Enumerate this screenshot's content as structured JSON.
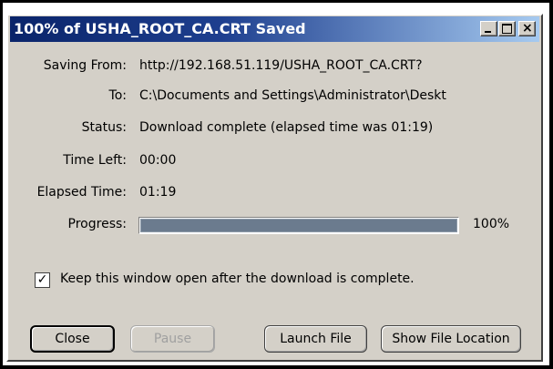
{
  "window": {
    "title": "100% of USHA_ROOT_CA.CRT Saved",
    "controls": {
      "minimize": "minimize-icon",
      "maximize": "maximize-icon",
      "close": "close-icon"
    }
  },
  "details": {
    "saving_from_label": "Saving From:",
    "saving_from_value": "http://192.168.51.119/USHA_ROOT_CA.CRT?",
    "to_label": "To:",
    "to_value": "C:\\Documents and Settings\\Administrator\\Deskt",
    "status_label": "Status:",
    "status_value": "Download complete (elapsed time was 01:19)",
    "time_left_label": "Time Left:",
    "time_left_value": "00:00",
    "elapsed_label": "Elapsed Time:",
    "elapsed_value": "01:19",
    "progress_label": "Progress:",
    "progress_text": "100%",
    "progress_fraction": 1.0
  },
  "options": {
    "keep_open_label": "Keep this window open after the download is complete.",
    "keep_open_checked": true
  },
  "buttons": {
    "close": "Close",
    "pause": "Pause",
    "launch": "Launch File",
    "show_location": "Show File Location"
  },
  "colors": {
    "titlebar_start": "#0a246a",
    "titlebar_end": "#a6caf0",
    "progress_fill": "#6b7b8e"
  }
}
